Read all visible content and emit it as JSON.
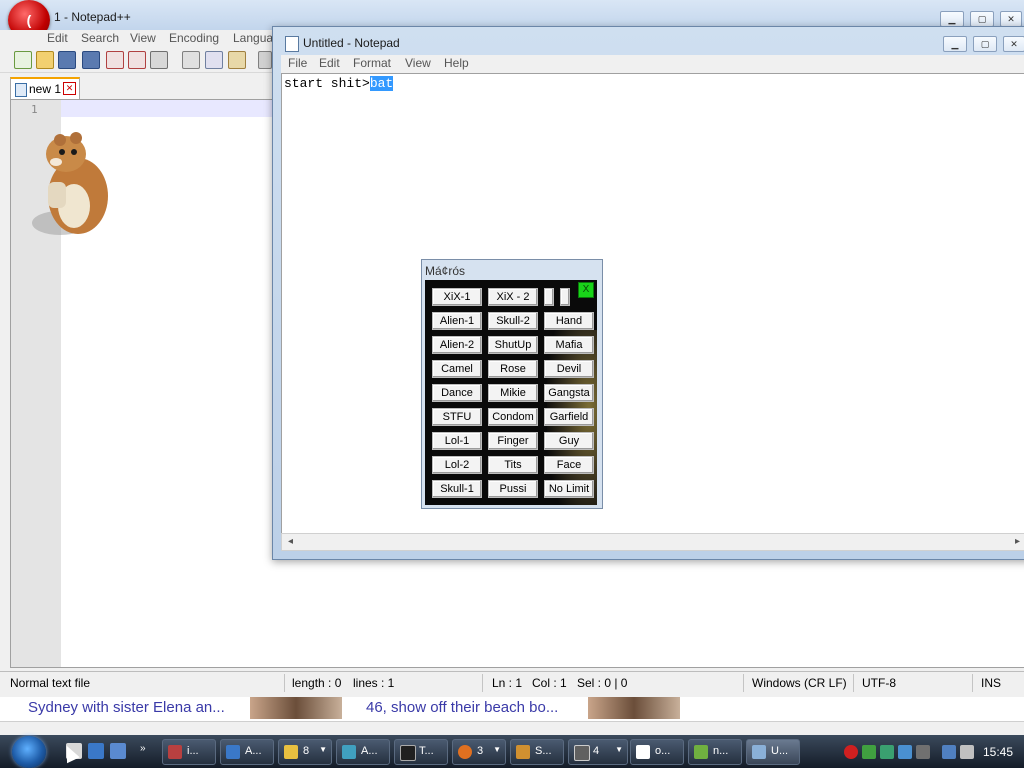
{
  "npp": {
    "title": "1 - Notepad++",
    "logo_text": "(",
    "menu": [
      "Edit",
      "Search",
      "View",
      "Encoding",
      "Langua"
    ],
    "tab_label": "new 1",
    "line_number": "1",
    "status": {
      "file_type": "Normal text file",
      "length": "length : 0",
      "lines": "lines : 1",
      "ln": "Ln : 1",
      "col": "Col : 1",
      "sel": "Sel : 0 | 0",
      "eol": "Windows (CR LF)",
      "encoding": "UTF-8",
      "mode": "INS"
    }
  },
  "notepad": {
    "title": "Untitled - Notepad",
    "menu": [
      "File",
      "Edit",
      "Format",
      "View",
      "Help"
    ],
    "text_before": "start shit>",
    "text_selected": "bat"
  },
  "macros": {
    "title": "Má¢rós",
    "close_label": "X",
    "buttons": [
      [
        "XiX-1",
        "XiX - 2",
        "",
        ""
      ],
      [
        "Alien-1",
        "Skull-2",
        "Hand"
      ],
      [
        "Alien-2",
        "ShutUp",
        "Mafia"
      ],
      [
        "Camel",
        "Rose",
        "Devil"
      ],
      [
        "Dance",
        "Mikie",
        "Gangsta"
      ],
      [
        "STFU",
        "Condom",
        "Garfield"
      ],
      [
        "Lol-1",
        "Finger",
        "Guy"
      ],
      [
        "Lol-2",
        "Tits",
        "Face"
      ],
      [
        "Skull-1",
        "Pussi",
        "No Limit"
      ]
    ]
  },
  "browser": {
    "text1": "Sydney with sister Elena an...",
    "text2": "46, show off their beach bo..."
  },
  "taskbar": {
    "tasks": [
      {
        "label": "i...",
        "icon_color": "#b84040"
      },
      {
        "label": "A...",
        "icon_color": "#3a78c8"
      },
      {
        "label": "8",
        "icon_color": "#e8c040",
        "dropdown": true
      },
      {
        "label": "A...",
        "icon_color": "#40a0c0"
      },
      {
        "label": "T...",
        "icon_color": "#202020"
      },
      {
        "label": "3",
        "icon_color": "#e07020",
        "dropdown": true
      },
      {
        "label": "S...",
        "icon_color": "#d09030"
      },
      {
        "label": "4",
        "icon_color": "#606060",
        "dropdown": true
      },
      {
        "label": "o...",
        "icon_color": "#ffffff"
      },
      {
        "label": "n...",
        "icon_color": "#70b040"
      },
      {
        "label": "U...",
        "icon_color": "#8ab0d8"
      }
    ],
    "clock": "15:45"
  }
}
